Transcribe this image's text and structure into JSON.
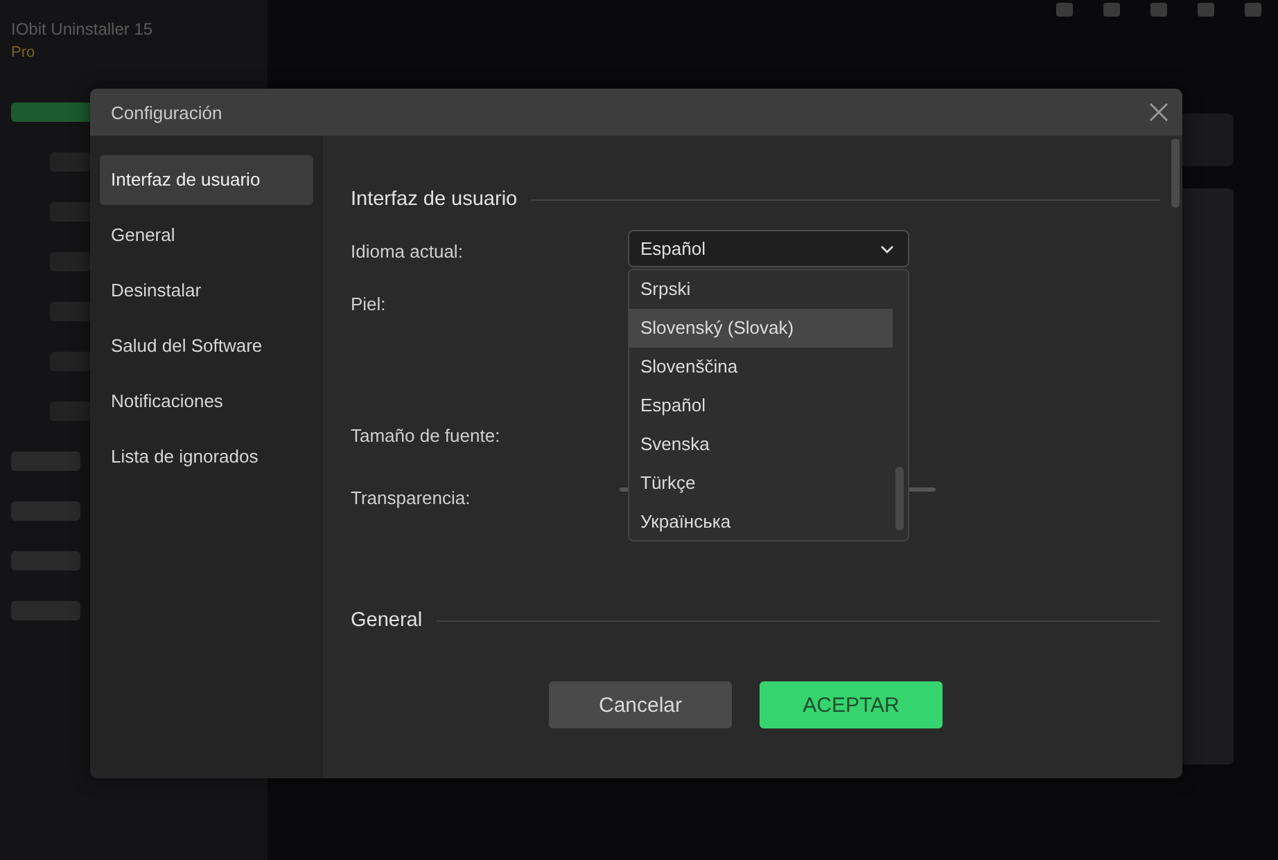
{
  "app": {
    "title": "IObit Uninstaller 15",
    "edition": "Pro"
  },
  "dialog": {
    "title": "Configuración",
    "nav": [
      {
        "label": "Interfaz de usuario",
        "selected": true
      },
      {
        "label": "General",
        "selected": false
      },
      {
        "label": "Desinstalar",
        "selected": false
      },
      {
        "label": "Salud del Software",
        "selected": false
      },
      {
        "label": "Notificaciones",
        "selected": false
      },
      {
        "label": "Lista de ignorados",
        "selected": false
      }
    ],
    "section": "Interfaz de usuario",
    "fields": [
      {
        "label": "Idioma actual:",
        "kind": "dropdown"
      },
      {
        "label": "Piel:",
        "kind": "skin"
      },
      {
        "label": "Tamaño de fuente:",
        "kind": "font"
      },
      {
        "label": "Transparencia:",
        "kind": "slider"
      }
    ],
    "language": {
      "value": "Español",
      "expanded": true,
      "options": [
        {
          "label": "Srpski",
          "highlighted": false
        },
        {
          "label": "Slovenský (Slovak)",
          "highlighted": true
        },
        {
          "label": "Slovenščina",
          "highlighted": false
        },
        {
          "label": "Español",
          "highlighted": false
        },
        {
          "label": "Svenska",
          "highlighted": false
        },
        {
          "label": "Türkçe",
          "highlighted": false
        },
        {
          "label": "Українська",
          "highlighted": false
        }
      ]
    },
    "next_section": "General",
    "buttons": [
      {
        "label": "Cancelar",
        "kind": "secondary"
      },
      {
        "label": "ACEPTAR",
        "kind": "primary"
      }
    ]
  }
}
